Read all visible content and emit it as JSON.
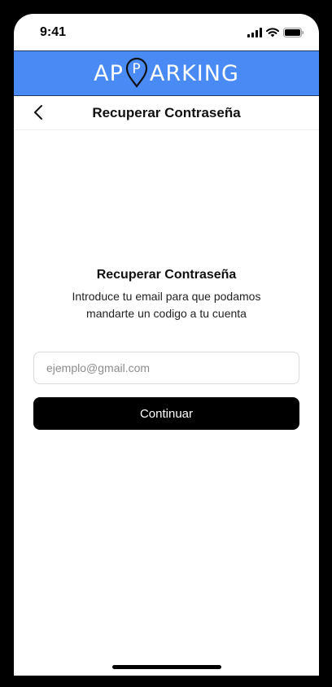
{
  "status_bar": {
    "time": "9:41",
    "icons": [
      "signal-icon",
      "wifi-icon",
      "battery-icon"
    ]
  },
  "brand": {
    "left_text": "AP",
    "pin_letter": "P",
    "right_text": "ARKING",
    "bar_color": "#4a8af4"
  },
  "nav": {
    "back_icon": "chevron-left-icon",
    "title": "Recuperar Contraseña"
  },
  "content": {
    "title": "Recuperar Contraseña",
    "description_line1": "Introduce tu email para que podamos",
    "description_line2": "mandarte un codigo a tu cuenta"
  },
  "form": {
    "email_placeholder": "ejemplo@gmail.com",
    "email_value": "",
    "continue_label": "Continuar"
  }
}
